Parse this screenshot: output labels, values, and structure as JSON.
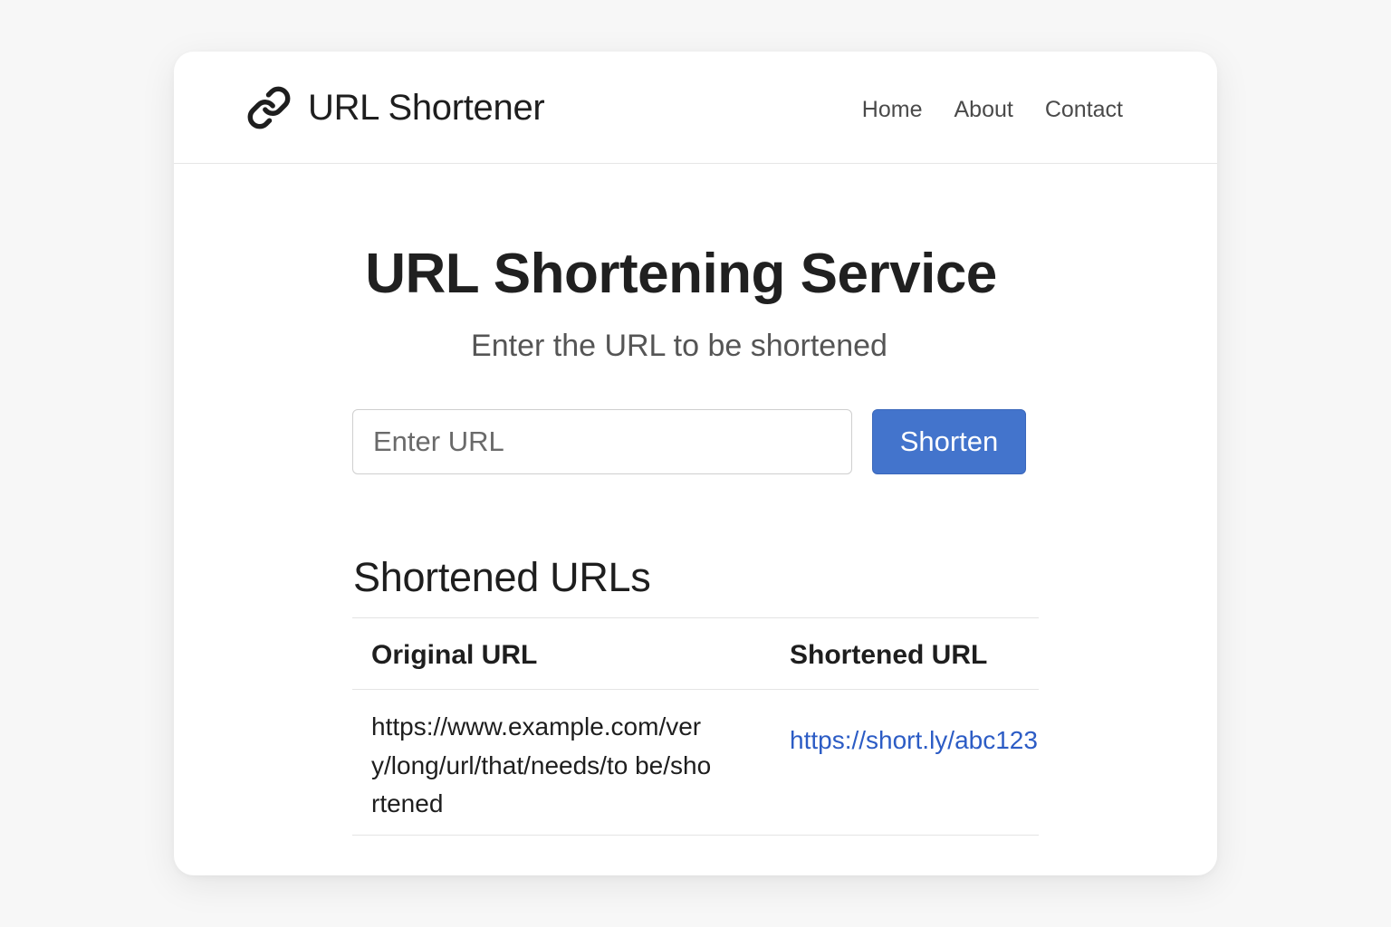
{
  "header": {
    "brand_icon": "link-icon",
    "brand_title": "URL Shortener",
    "nav": [
      {
        "label": "Home"
      },
      {
        "label": "About"
      },
      {
        "label": "Contact"
      }
    ]
  },
  "main": {
    "title": "URL Shortening Service",
    "subtitle": "Enter the URL to be shortened",
    "input": {
      "placeholder": "Enter URL",
      "value": ""
    },
    "shorten_button": "Shorten",
    "history": {
      "title": "Shortened URLs",
      "columns": [
        "Original URL",
        "Shortened URL"
      ],
      "rows": [
        {
          "original": "https://www.example.com/very/long/url/that/needs/to be/shortened",
          "shortened": "https://short.ly/abc123"
        }
      ]
    }
  },
  "colors": {
    "accent": "#4374cc",
    "link": "#2c5cc5",
    "background": "#f7f7f7",
    "card": "#ffffff"
  }
}
